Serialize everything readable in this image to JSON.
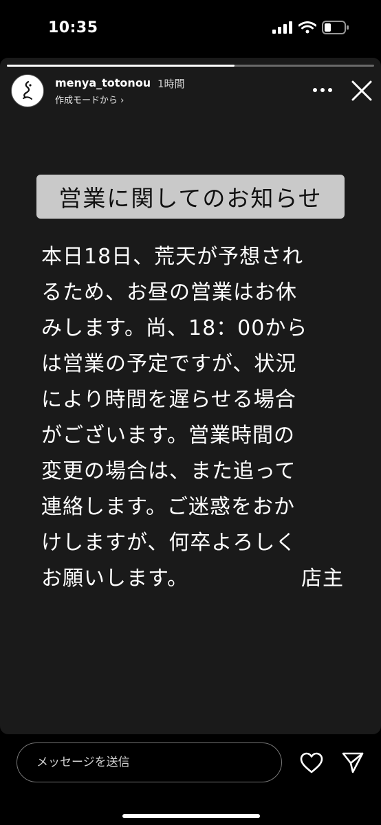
{
  "status_bar": {
    "time": "10:35"
  },
  "story": {
    "progress": 0.62,
    "username": "menya_totonou",
    "post_time": "1時間",
    "created_from": "作成モードから ›",
    "notice_title": "営業に関してのお知らせ",
    "notice_lines": [
      "本日18日、荒天が予想され",
      "るため、お昼の営業はお休",
      "みします。尚、18：00から",
      "は営業の予定ですが、状況",
      "により時間を遅らせる場合",
      "がございます。営業時間の",
      "変更の場合は、また追って",
      "連絡します。ご迷惑をおか",
      "けしますが、何卒よろしく",
      "お願いします。"
    ],
    "signature": "店主"
  },
  "reply": {
    "placeholder": "メッセージを送信"
  },
  "icons": {
    "signal": "signal-icon",
    "wifi": "wifi-icon",
    "battery": "battery-icon",
    "more": "more-icon",
    "close": "close-icon",
    "heart": "heart-icon",
    "send": "send-icon"
  }
}
